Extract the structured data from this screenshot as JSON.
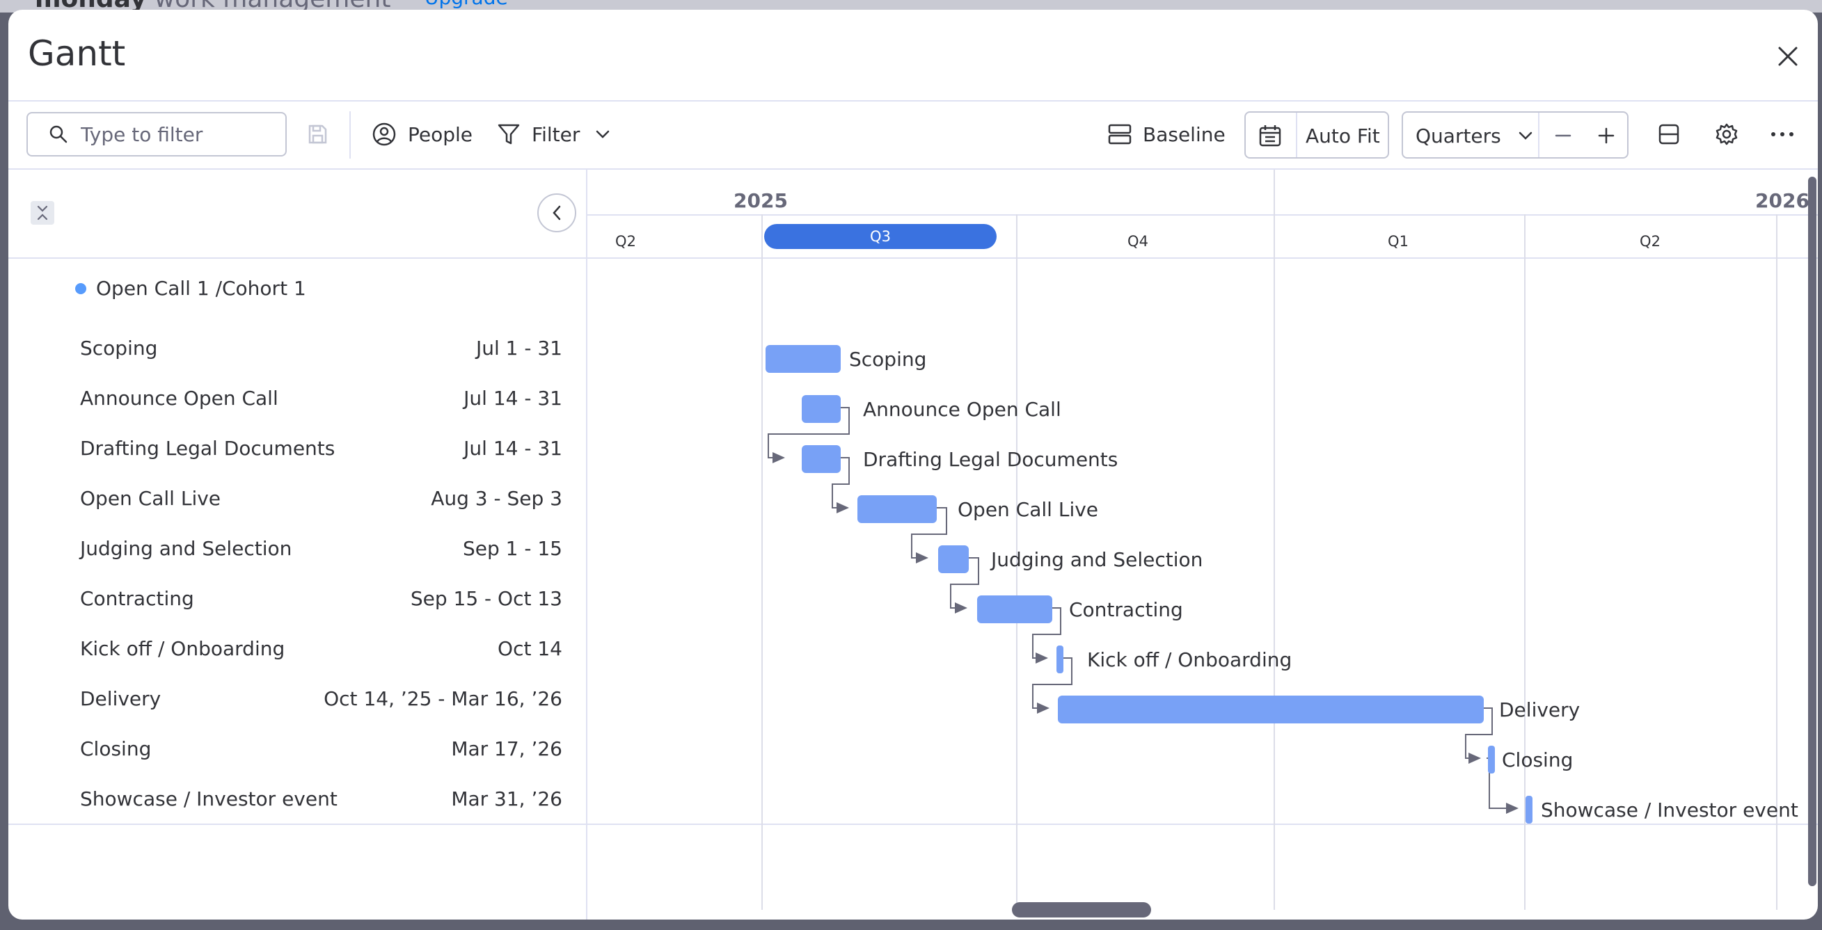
{
  "background": {
    "brand_bold": "monday",
    "brand_rest": " work management",
    "upgrade": "Upgrade"
  },
  "modal": {
    "title": "Gantt"
  },
  "toolbar": {
    "search_placeholder": "Type to filter",
    "people_label": "People",
    "filter_label": "Filter",
    "baseline_label": "Baseline",
    "autofit_label": "Auto Fit",
    "scale_value": "Quarters"
  },
  "timeline": {
    "years": [
      "2025",
      "2026"
    ],
    "quarters": [
      "Q2",
      "Q3",
      "Q4",
      "Q1",
      "Q2"
    ],
    "selected_quarter": "Q3"
  },
  "group": {
    "name": "Open Call 1 /Cohort 1",
    "color": "#579bfc"
  },
  "tasks": [
    {
      "name": "Scoping",
      "dates": "Jul 1 - 31"
    },
    {
      "name": "Announce Open Call",
      "dates": "Jul 14 - 31"
    },
    {
      "name": "Drafting Legal Documents",
      "dates": "Jul 14 - 31"
    },
    {
      "name": "Open Call Live",
      "dates": "Aug 3 - Sep 3"
    },
    {
      "name": "Judging and Selection",
      "dates": "Sep 1 - 15"
    },
    {
      "name": "Contracting",
      "dates": "Sep 15 - Oct 13"
    },
    {
      "name": "Kick off / Onboarding",
      "dates": "Oct 14"
    },
    {
      "name": "Delivery",
      "dates": "Oct 14, ’25 - Mar 16, ’26"
    },
    {
      "name": "Closing",
      "dates": "Mar 17, ’26"
    },
    {
      "name": "Showcase / Investor event",
      "dates": "Mar 31, ’26"
    }
  ],
  "colors": {
    "bar": "#78a1f6",
    "accent": "#3a72e0"
  }
}
